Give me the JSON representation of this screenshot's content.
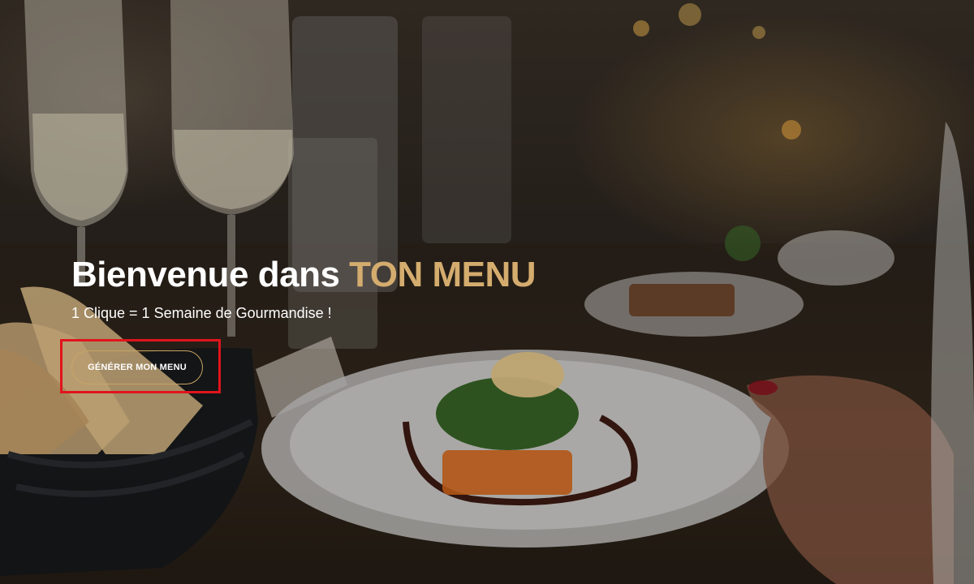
{
  "hero": {
    "title_prefix": "Bienvenue dans",
    "title_accent": "TON MENU",
    "subtitle": "1 Clique = 1 Semaine de Gourmandise !",
    "cta_label": "GÉNÉRER MON MENU"
  },
  "colors": {
    "accent_gold": "#d4ac6e",
    "button_border": "#c9a464",
    "highlight_red": "#e0141c",
    "text_white": "#ffffff"
  },
  "background_image": {
    "icons": [
      "champagne-glass-icon",
      "bread-basket-icon",
      "plated-dish-icon",
      "hand-icon"
    ]
  }
}
